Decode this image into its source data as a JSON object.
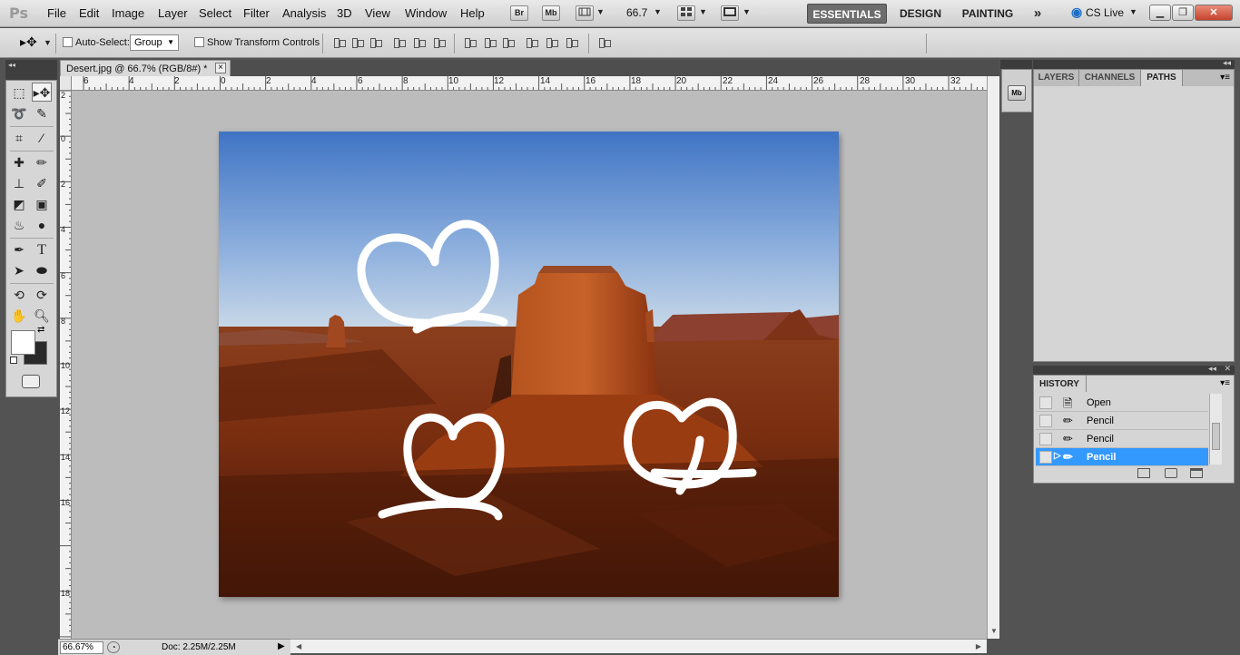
{
  "app": {
    "logo": "Ps"
  },
  "menu": [
    "File",
    "Edit",
    "Image",
    "Layer",
    "Select",
    "Filter",
    "Analysis",
    "3D",
    "View",
    "Window",
    "Help"
  ],
  "appbar": {
    "bridge": "Br",
    "minibridge": "Mb",
    "zoom": "66.7"
  },
  "workspaces": [
    "ESSENTIALS",
    "DESIGN",
    "PAINTING",
    "»"
  ],
  "cslive": "CS Live",
  "options": {
    "auto_select_label": "Auto-Select:",
    "auto_select_value": "Group",
    "show_transform_label": "Show Transform Controls"
  },
  "document": {
    "tab_title": "Desert.jpg @ 66.7% (RGB/8#) *",
    "close_glyph": "×"
  },
  "ruler_top_labels": [
    "6",
    "4",
    "2",
    "0",
    "2",
    "4",
    "6",
    "8",
    "10",
    "12",
    "14",
    "16",
    "18",
    "20",
    "22",
    "24",
    "26",
    "28",
    "30",
    "32"
  ],
  "ruler_left_labels": [
    "2",
    "0",
    "2",
    "4",
    "6",
    "8",
    "10",
    "12",
    "14",
    "16",
    "18"
  ],
  "status": {
    "zoom": "66.67%",
    "doc": "Doc: 2.25M/2.25M"
  },
  "panels": {
    "tabs": [
      "LAYERS",
      "CHANNELS",
      "PATHS"
    ],
    "active_tab": "PATHS",
    "minibridge_icon": "Mb"
  },
  "history": {
    "title": "HISTORY",
    "items": [
      {
        "label": "Open",
        "icon": "document-icon",
        "selected": false
      },
      {
        "label": "Pencil",
        "icon": "pencil-icon",
        "selected": false
      },
      {
        "label": "Pencil",
        "icon": "pencil-icon",
        "selected": false
      },
      {
        "label": "Pencil",
        "icon": "pencil-icon",
        "selected": true
      }
    ]
  },
  "colors": {
    "foreground": "#ffffff",
    "background": "#2a2a2a",
    "selection": "#3399ff",
    "sky_top": "#3f74c4",
    "rock": "#9a3c12"
  }
}
